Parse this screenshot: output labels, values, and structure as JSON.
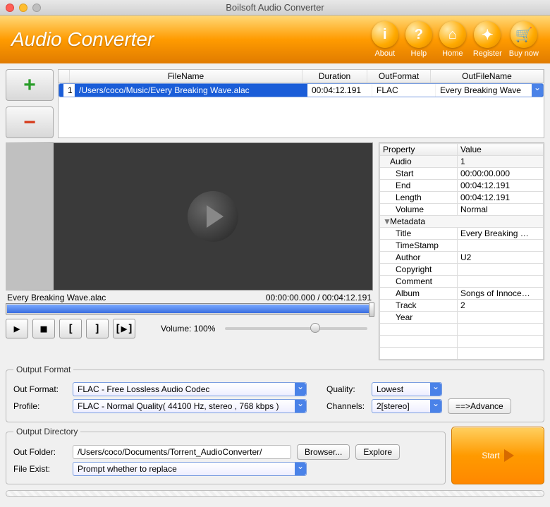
{
  "window": {
    "title": "Boilsoft Audio Converter"
  },
  "header": {
    "title": "Audio Converter",
    "buttons": [
      {
        "label": "About",
        "glyph": "i"
      },
      {
        "label": "Help",
        "glyph": "?"
      },
      {
        "label": "Home",
        "glyph": "⌂"
      },
      {
        "label": "Register",
        "glyph": "✦"
      },
      {
        "label": "Buy now",
        "glyph": "🛒"
      }
    ]
  },
  "filelist": {
    "columns": {
      "filename": "FileName",
      "duration": "Duration",
      "outformat": "OutFormat",
      "outfilename": "OutFileName"
    },
    "rows": [
      {
        "idx": "1",
        "filename": "/Users/coco/Music/Every Breaking Wave.alac",
        "duration": "00:04:12.191",
        "outformat": "FLAC",
        "outfilename": "Every Breaking Wave"
      }
    ]
  },
  "player": {
    "filename": "Every Breaking Wave.alac",
    "timecode": "00:00:00.000 / 00:04:12.191",
    "volume_label": "Volume: 100%"
  },
  "properties": {
    "head": {
      "property": "Property",
      "value": "Value"
    },
    "audio_group": "Audio",
    "audio": {
      "count": "1",
      "start_k": "Start",
      "start_v": "00:00:00.000",
      "end_k": "End",
      "end_v": "00:04:12.191",
      "length_k": "Length",
      "length_v": "00:04:12.191",
      "volume_k": "Volume",
      "volume_v": "Normal"
    },
    "metadata_group": "Metadata",
    "meta": {
      "title_k": "Title",
      "title_v": "Every Breaking …",
      "timestamp_k": "TimeStamp",
      "timestamp_v": "",
      "author_k": "Author",
      "author_v": "U2",
      "copyright_k": "Copyright",
      "copyright_v": "",
      "comment_k": "Comment",
      "comment_v": "",
      "album_k": "Album",
      "album_v": "Songs of Innoce…",
      "track_k": "Track",
      "track_v": "2",
      "year_k": "Year",
      "year_v": ""
    }
  },
  "output_format": {
    "legend": "Output Format",
    "outformat_label": "Out Format:",
    "outformat_value": "FLAC - Free Lossless Audio Codec",
    "profile_label": "Profile:",
    "profile_value": "FLAC - Normal Quality( 44100 Hz, stereo , 768 kbps )",
    "quality_label": "Quality:",
    "quality_value": "Lowest",
    "channels_label": "Channels:",
    "channels_value": "2[stereo]",
    "advance_label": "==>Advance"
  },
  "output_dir": {
    "legend": "Output Directory",
    "outfolder_label": "Out Folder:",
    "outfolder_value": "/Users/coco/Documents/Torrent_AudioConverter/",
    "browser_label": "Browser...",
    "explore_label": "Explore",
    "fileexist_label": "File Exist:",
    "fileexist_value": "Prompt whether to replace",
    "start_label": "Start"
  }
}
